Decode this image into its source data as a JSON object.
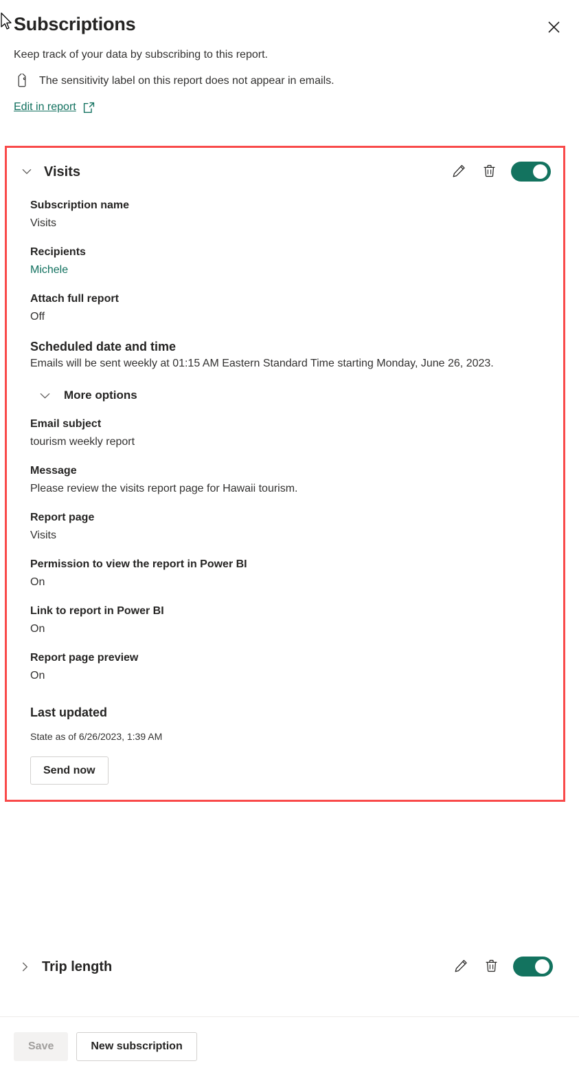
{
  "header": {
    "title": "Subscriptions",
    "close_icon": "close-icon",
    "subtitle": "Keep track of your data by subscribing to this report.",
    "sensitivity_icon": "tag-icon",
    "sensitivity_text": "The sensitivity label on this report does not appear in emails.",
    "edit_link": "Edit in report",
    "external_link_icon": "external-link-icon"
  },
  "subscriptions": [
    {
      "name": "Visits",
      "expanded": true,
      "chevron_icon": "chevron-down-icon",
      "edit_icon": "pencil-icon",
      "delete_icon": "trash-icon",
      "toggle_state": "on",
      "fields": {
        "subscription_name_label": "Subscription name",
        "subscription_name_value": "Visits",
        "recipients_label": "Recipients",
        "recipients_value": "Michele",
        "attach_label": "Attach full report",
        "attach_value": "Off",
        "schedule_label": "Scheduled date and time",
        "schedule_value": "Emails will be sent weekly at 01:15 AM Eastern Standard Time starting Monday, June 26, 2023.",
        "more_options_label": "More options",
        "more_options_chevron": "chevron-down-icon",
        "email_subject_label": "Email subject",
        "email_subject_value": "tourism weekly report",
        "message_label": "Message",
        "message_value": "Please review the visits report page for Hawaii tourism.",
        "report_page_label": "Report page",
        "report_page_value": "Visits",
        "permission_label": "Permission to view the report in Power BI",
        "permission_value": "On",
        "link_label": "Link to report in Power BI",
        "link_value": "On",
        "preview_label": "Report page preview",
        "preview_value": "On",
        "last_updated_label": "Last updated",
        "last_updated_value": "State as of 6/26/2023, 1:39 AM",
        "send_now_label": "Send now"
      }
    },
    {
      "name": "Trip length",
      "expanded": false,
      "chevron_icon": "chevron-right-icon",
      "edit_icon": "pencil-icon",
      "delete_icon": "trash-icon",
      "toggle_state": "on"
    }
  ],
  "footer": {
    "save_label": "Save",
    "save_disabled": true,
    "new_subscription_label": "New subscription"
  },
  "colors": {
    "accent_teal": "#13735f",
    "link_teal": "#10705e",
    "highlight_red": "#f94a4a",
    "text_primary": "#252423",
    "text_secondary": "#323130",
    "disabled_bg": "#f3f2f1",
    "disabled_text": "#a19f9d"
  }
}
